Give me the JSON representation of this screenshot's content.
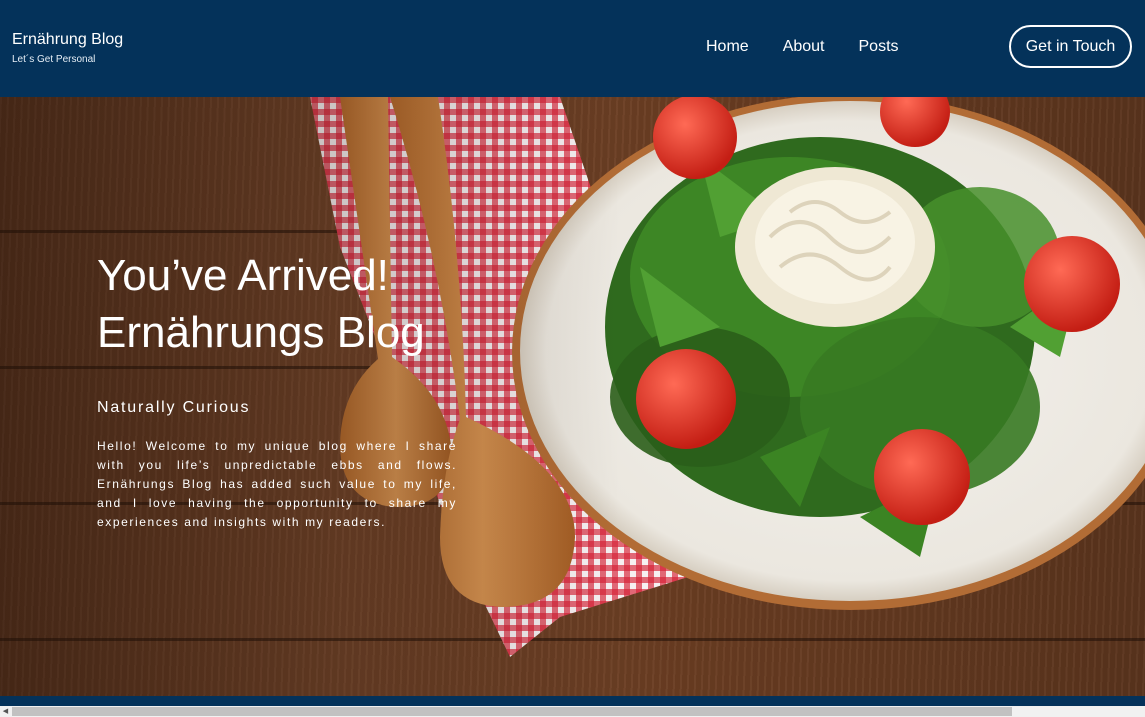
{
  "header": {
    "brand_title": "Ernährung Blog",
    "brand_subtitle": "Let´s Get Personal",
    "nav": [
      {
        "label": "Home"
      },
      {
        "label": "About"
      },
      {
        "label": "Posts"
      }
    ],
    "cta_label": "Get in Touch"
  },
  "hero": {
    "title_line1": "You’ve Arrived!",
    "title_line2": "Ernährungs Blog",
    "kicker": "Naturally Curious",
    "body": "Hello! Welcome to my unique blog where I share with you life’s unpredictable ebbs and flows. Ernährungs Blog has added such value to my life, and I love having the opportunity to share my experiences and insights with my readers."
  },
  "colors": {
    "header_bg": "#04325a",
    "text": "#ffffff"
  }
}
